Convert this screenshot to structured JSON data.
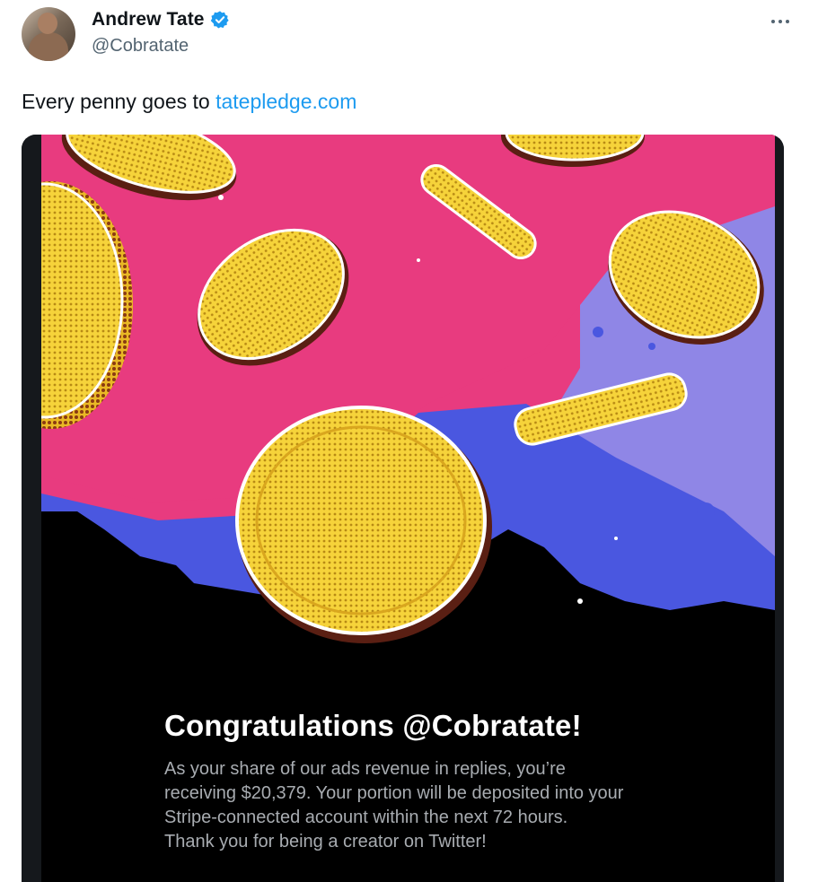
{
  "tweet": {
    "author_name": "Andrew Tate",
    "handle": "@Cobratate",
    "text_prefix": "Every penny goes to ",
    "link_text": "tatepledge.com",
    "verified": true
  },
  "card": {
    "title": "Congratulations @Cobratate!",
    "body_lines": [
      "As your share of our ads revenue in replies, you’re",
      "receiving $20,379. Your portion will be deposited into your",
      "Stripe-connected account within the next 72 hours.",
      "Thank you for being a creator on Twitter!"
    ]
  },
  "icons": {
    "verified": "verified-badge-icon",
    "more": "more-options-icon"
  },
  "colors": {
    "link": "#1d9bf0",
    "verified": "#1d9bf0",
    "pink": "#e83b7f",
    "blue": "#4a57e0",
    "coin": "#f6d33a"
  }
}
